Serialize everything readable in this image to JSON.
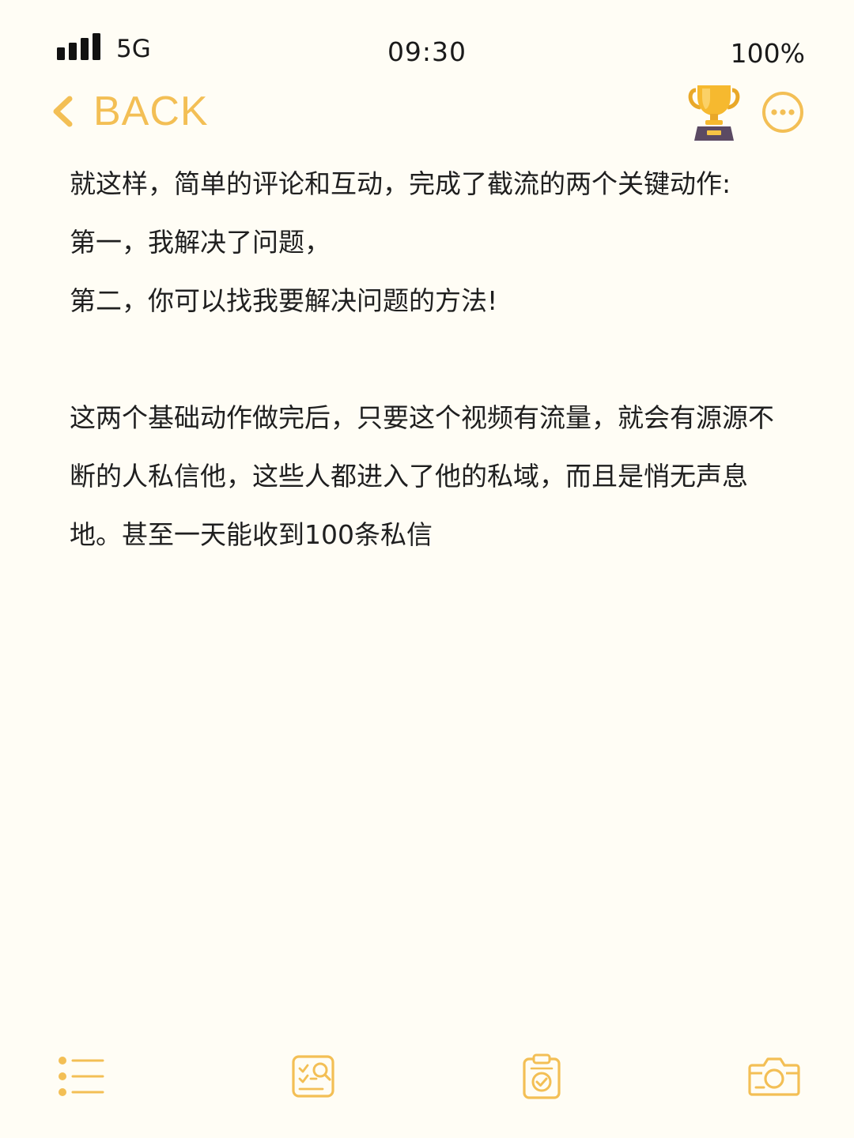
{
  "status_bar": {
    "network": "5G",
    "time": "09:30",
    "battery": "100%"
  },
  "nav": {
    "back_label": "BACK",
    "accent_color": "#f3bf55",
    "icons": [
      "chevron-left-icon",
      "trophy-icon",
      "more-icon"
    ]
  },
  "content": {
    "lines": [
      "就这样，简单的评论和互动，完成了截流的两个关键动作:",
      "第一，我解决了问题，",
      "第二，你可以找我要解决问题的方法!"
    ],
    "paragraph": "这两个基础动作做完后，只要这个视频有流量，就会有源源不断的人私信他，这些人都进入了他的私域，而且是悄无声息地。甚至一天能收到100条私信"
  },
  "toolbar": {
    "icons": [
      "list-icon",
      "checklist-search-icon",
      "clipboard-check-icon",
      "camera-icon"
    ]
  }
}
